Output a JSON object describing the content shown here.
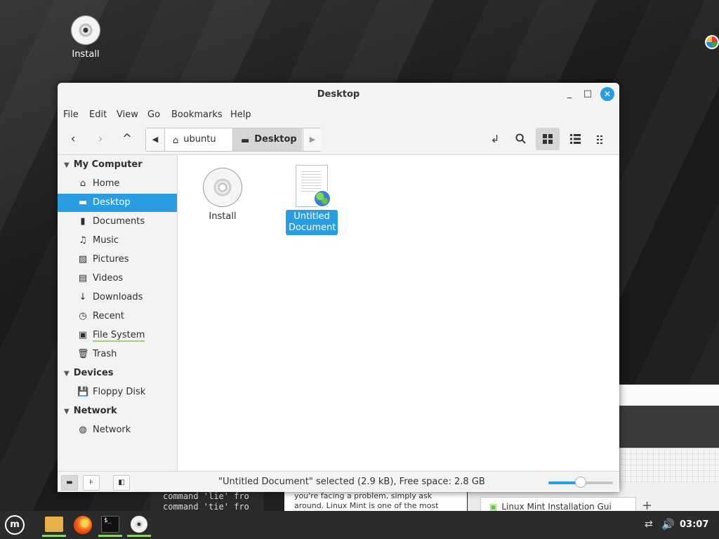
{
  "desktop": {
    "icons": [
      {
        "label": "Install",
        "icon": "disc-icon"
      }
    ]
  },
  "window": {
    "title": "Desktop",
    "controls": {
      "minimize": "_",
      "maximize": "□",
      "close": "✕"
    },
    "menu": [
      "File",
      "Edit",
      "View",
      "Go",
      "Bookmarks",
      "Help"
    ],
    "toolbar": {
      "back": "‹",
      "forward": "›",
      "up": "^",
      "path": [
        {
          "label": "ubuntu",
          "icon": "home-icon"
        },
        {
          "label": "Desktop",
          "icon": "desktop-icon"
        }
      ]
    },
    "sidebar": {
      "sections": [
        {
          "header": "My Computer",
          "items": [
            {
              "label": "Home",
              "icon": "home-icon"
            },
            {
              "label": "Desktop",
              "icon": "desktop-icon",
              "selected": true
            },
            {
              "label": "Documents",
              "icon": "document-icon"
            },
            {
              "label": "Music",
              "icon": "music-icon"
            },
            {
              "label": "Pictures",
              "icon": "pictures-icon"
            },
            {
              "label": "Videos",
              "icon": "videos-icon"
            },
            {
              "label": "Downloads",
              "icon": "download-icon"
            },
            {
              "label": "Recent",
              "icon": "recent-icon"
            },
            {
              "label": "File System",
              "icon": "drive-icon"
            },
            {
              "label": "Trash",
              "icon": "trash-icon"
            }
          ]
        },
        {
          "header": "Devices",
          "items": [
            {
              "label": "Floppy Disk",
              "icon": "floppy-icon"
            }
          ]
        },
        {
          "header": "Network",
          "items": [
            {
              "label": "Network",
              "icon": "globe-icon"
            }
          ]
        }
      ]
    },
    "files": [
      {
        "label": "Install",
        "icon": "disc-icon"
      },
      {
        "label_line1": "Untitled",
        "label_line2": "Document",
        "icon": "document-globe-icon",
        "selected": true
      }
    ],
    "status": {
      "text": "\"Untitled Document\" selected (2.9 kB), Free space: 2.8 GB",
      "zoom_level": 0.5
    }
  },
  "background": {
    "terminal_lines": [
      "command 'lie' fro",
      "command 'tie' fro"
    ],
    "article_lines": [
      "you're facing a problem, simply ask",
      "around. Linux Mint is one of the most"
    ],
    "browser_tab": "Linux Mint Installation Gui",
    "browser_tab_plus": "+"
  },
  "taskbar": {
    "clock": "03:07",
    "apps": [
      "menu",
      "files",
      "firefox",
      "terminal",
      "disc"
    ],
    "terminal_glyph": "$_"
  },
  "colors": {
    "accent": "#2a9de0",
    "active_indicator": "#8fd16a"
  }
}
